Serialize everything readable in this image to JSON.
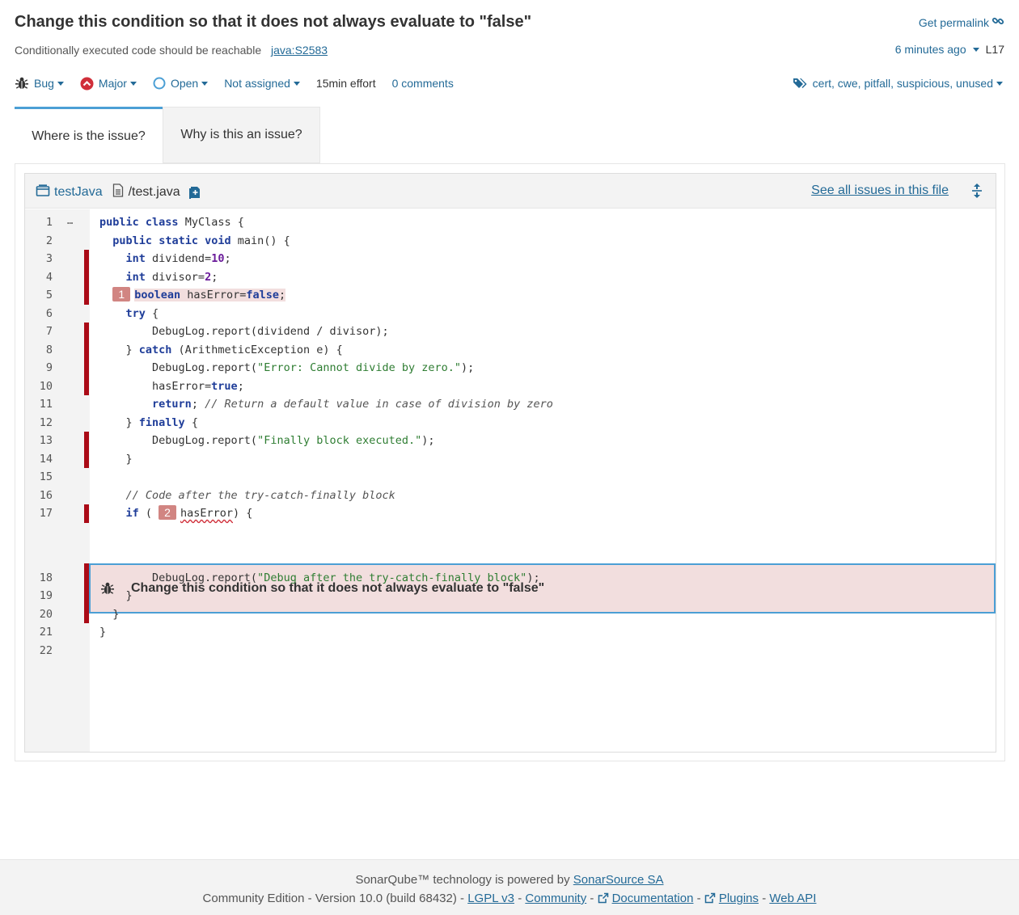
{
  "issue": {
    "title": "Change this condition so that it does not always evaluate to \"false\"",
    "permalink_label": "Get permalink",
    "rule_name": "Conditionally executed code should be reachable",
    "rule_key": "java:S2583",
    "age": "6 minutes ago",
    "line": "L17",
    "type": "Bug",
    "severity": "Major",
    "status": "Open",
    "assignee": "Not assigned",
    "effort": "15min effort",
    "comments": "0 comments",
    "tags": "cert, cwe, pitfall, suspicious, unused"
  },
  "tabs": [
    {
      "label": "Where is the issue?"
    },
    {
      "label": "Why is this an issue?"
    }
  ],
  "viewer": {
    "project": "testJava",
    "file": "/test.java",
    "see_all": "See all issues in this file",
    "issue_message": "Change this condition so that it does not always evaluate to \"false\""
  },
  "code_lines": [
    {
      "n": "1",
      "text": "public class MyClass {"
    },
    {
      "n": "2",
      "text": "  public static void main() {"
    },
    {
      "n": "3",
      "text": "    int dividend=10;"
    },
    {
      "n": "4",
      "text": "    int divisor=2;"
    },
    {
      "n": "5",
      "text": "    boolean hasError=false;",
      "marker": "1"
    },
    {
      "n": "6",
      "text": "    try {"
    },
    {
      "n": "7",
      "text": "        DebugLog.report(dividend / divisor);"
    },
    {
      "n": "8",
      "text": "    } catch (ArithmeticException e) {"
    },
    {
      "n": "9",
      "text": "        DebugLog.report(\"Error: Cannot divide by zero.\");"
    },
    {
      "n": "10",
      "text": "        hasError=true;"
    },
    {
      "n": "11",
      "text": "        return; // Return a default value in case of division by zero"
    },
    {
      "n": "12",
      "text": "    } finally {"
    },
    {
      "n": "13",
      "text": "        DebugLog.report(\"Finally block executed.\");"
    },
    {
      "n": "14",
      "text": "    }"
    },
    {
      "n": "15",
      "text": ""
    },
    {
      "n": "16",
      "text": "    // Code after the try-catch-finally block"
    },
    {
      "n": "17",
      "text": "    if ( hasError) {",
      "marker": "2"
    },
    {
      "n": "18",
      "text": "        DebugLog.report(\"Debug after the try-catch-finally block\");"
    },
    {
      "n": "19",
      "text": "    }"
    },
    {
      "n": "20",
      "text": "  }"
    },
    {
      "n": "21",
      "text": "}"
    },
    {
      "n": "22",
      "text": ""
    }
  ],
  "footer": {
    "powered_prefix": "SonarQube™ technology is powered by",
    "powered_link": "SonarSource SA",
    "edition": "Community Edition - Version 10.0 (build 68432) -",
    "lgpl": "LGPL v3",
    "community": "Community",
    "documentation": "Documentation",
    "plugins": "Plugins",
    "webapi": "Web API"
  },
  "colors": {
    "accent": "#236a97",
    "scm_bar": "#aa0a16",
    "issue_bg": "#f2dede",
    "tab_active_border": "#4b9fd5",
    "marker_bg": "#d18582"
  }
}
